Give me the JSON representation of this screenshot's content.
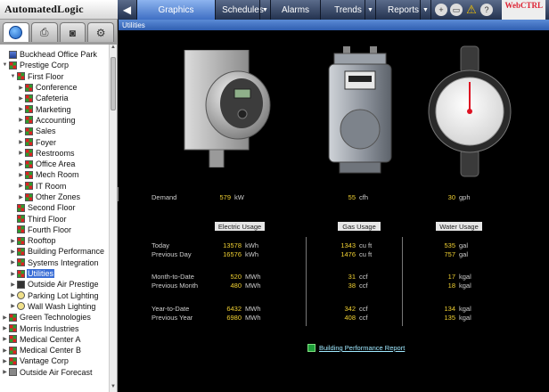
{
  "brand": {
    "logo": "AutomatedLogic",
    "watermark": "WebCTRL"
  },
  "nav": {
    "tabs": [
      {
        "label": "Graphics",
        "active": true,
        "dropdown": false
      },
      {
        "label": "Schedules",
        "dropdown": true
      },
      {
        "label": "Alarms",
        "dropdown": false
      },
      {
        "label": "Trends",
        "dropdown": true
      },
      {
        "label": "Reports",
        "dropdown": true
      }
    ],
    "help": "?"
  },
  "breadcrumb": "Utilities",
  "tree": [
    {
      "label": "Buckhead Office Park",
      "level": 0,
      "expander": "",
      "icon": "site"
    },
    {
      "label": "Prestige Corp",
      "level": 0,
      "expander": "▼",
      "icon": "equip"
    },
    {
      "label": "First Floor",
      "level": 1,
      "expander": "▼",
      "icon": "equip"
    },
    {
      "label": "Conference",
      "level": 2,
      "expander": "▶",
      "icon": "equip"
    },
    {
      "label": "Cafeteria",
      "level": 2,
      "expander": "▶",
      "icon": "equip"
    },
    {
      "label": "Marketing",
      "level": 2,
      "expander": "▶",
      "icon": "equip"
    },
    {
      "label": "Accounting",
      "level": 2,
      "expander": "▶",
      "icon": "equip"
    },
    {
      "label": "Sales",
      "level": 2,
      "expander": "▶",
      "icon": "equip"
    },
    {
      "label": "Foyer",
      "level": 2,
      "expander": "▶",
      "icon": "equip"
    },
    {
      "label": "Restrooms",
      "level": 2,
      "expander": "▶",
      "icon": "equip"
    },
    {
      "label": "Office Area",
      "level": 2,
      "expander": "▶",
      "icon": "equip"
    },
    {
      "label": "Mech Room",
      "level": 2,
      "expander": "▶",
      "icon": "equip"
    },
    {
      "label": "IT Room",
      "level": 2,
      "expander": "▶",
      "icon": "equip"
    },
    {
      "label": "Other Zones",
      "level": 2,
      "expander": "▶",
      "icon": "equip"
    },
    {
      "label": "Second Floor",
      "level": 1,
      "expander": "",
      "icon": "equip"
    },
    {
      "label": "Third Floor",
      "level": 1,
      "expander": "",
      "icon": "equip"
    },
    {
      "label": "Fourth Floor",
      "level": 1,
      "expander": "",
      "icon": "equip"
    },
    {
      "label": "Rooftop",
      "level": 1,
      "expander": "▶",
      "icon": "equip"
    },
    {
      "label": "Building Performance",
      "level": 1,
      "expander": "▶",
      "icon": "equip"
    },
    {
      "label": "Systems Integration",
      "level": 1,
      "expander": "▶",
      "icon": "equip"
    },
    {
      "label": "Utilities",
      "level": 1,
      "expander": "▶",
      "icon": "equip",
      "selected": true
    },
    {
      "label": "Outside Air Prestige",
      "level": 1,
      "expander": "▶",
      "icon": "air"
    },
    {
      "label": "Parking Lot Lighting",
      "level": 1,
      "expander": "▶",
      "icon": "bulb"
    },
    {
      "label": "Wall Wash Lighting",
      "level": 1,
      "expander": "▶",
      "icon": "bulb"
    },
    {
      "label": "Green Technologies",
      "level": 0,
      "expander": "▶",
      "icon": "equip"
    },
    {
      "label": "Morris Industries",
      "level": 0,
      "expander": "▶",
      "icon": "equip"
    },
    {
      "label": "Medical Center A",
      "level": 0,
      "expander": "▶",
      "icon": "equip"
    },
    {
      "label": "Medical Center B",
      "level": 0,
      "expander": "▶",
      "icon": "equip"
    },
    {
      "label": "Vantage Corp",
      "level": 0,
      "expander": "▶",
      "icon": "equip"
    },
    {
      "label": "Outside Air Forecast",
      "level": 0,
      "expander": "▶",
      "icon": "gray"
    }
  ],
  "demand": {
    "label": "Demand",
    "electric": {
      "value": "579",
      "unit": "kW"
    },
    "gas": {
      "value": "55",
      "unit": "cfh"
    },
    "water": {
      "value": "30",
      "unit": "gph"
    }
  },
  "columns": {
    "electric": "Electric Usage",
    "gas": "Gas Usage",
    "water": "Water Usage"
  },
  "rows": [
    {
      "label": "Today",
      "electric": [
        "13578",
        "kWh"
      ],
      "gas": [
        "1343",
        "cu ft"
      ],
      "water": [
        "535",
        "gal"
      ]
    },
    {
      "label": "Previous Day",
      "electric": [
        "16576",
        "kWh"
      ],
      "gas": [
        "1476",
        "cu ft"
      ],
      "water": [
        "757",
        "gal"
      ]
    },
    {
      "label": "Month-to-Date",
      "electric": [
        "520",
        "MWh"
      ],
      "gas": [
        "31",
        "ccf"
      ],
      "water": [
        "17",
        "kgal"
      ]
    },
    {
      "label": "Previous Month",
      "electric": [
        "480",
        "MWh"
      ],
      "gas": [
        "38",
        "ccf"
      ],
      "water": [
        "18",
        "kgal"
      ]
    },
    {
      "label": "Year-to-Date",
      "electric": [
        "6432",
        "MWh"
      ],
      "gas": [
        "342",
        "ccf"
      ],
      "water": [
        "134",
        "kgal"
      ]
    },
    {
      "label": "Previous Year",
      "electric": [
        "6980",
        "MWh"
      ],
      "gas": [
        "408",
        "ccf"
      ],
      "water": [
        "135",
        "kgal"
      ]
    }
  ],
  "report_link": "Building Performance Report",
  "icons": {
    "back": "back-arrow-icon",
    "tools": [
      "add-icon",
      "print-icon",
      "warning-icon",
      "help-icon"
    ],
    "sidetabs": [
      "globe-icon",
      "printer-icon",
      "camera-icon",
      "gear-icon"
    ]
  }
}
